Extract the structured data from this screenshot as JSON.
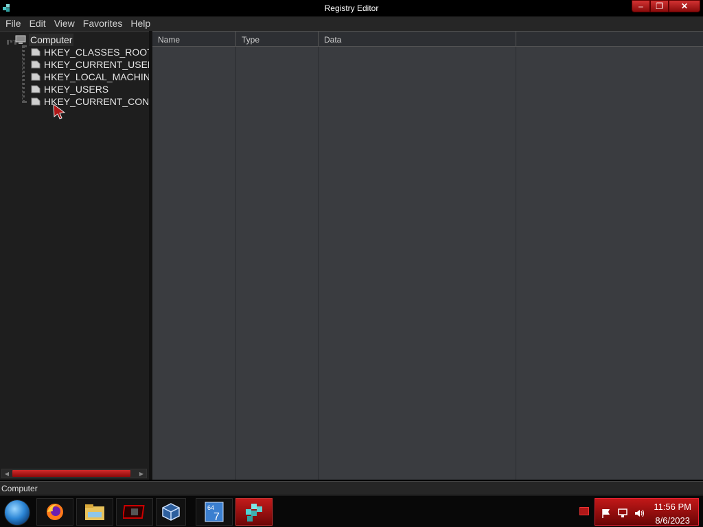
{
  "window": {
    "title": "Registry Editor",
    "min_glyph": "–",
    "max_glyph": "❐",
    "close_glyph": "✕"
  },
  "menu": {
    "items": [
      "File",
      "Edit",
      "View",
      "Favorites",
      "Help"
    ]
  },
  "tree": {
    "root": "Computer",
    "keys": [
      "HKEY_CLASSES_ROOT",
      "HKEY_CURRENT_USER",
      "HKEY_LOCAL_MACHINE",
      "HKEY_USERS",
      "HKEY_CURRENT_CONFIG"
    ]
  },
  "list": {
    "columns": [
      "Name",
      "Type",
      "Data"
    ]
  },
  "status": {
    "path": "Computer"
  },
  "taskbar": {
    "items": [
      "firefox-icon",
      "file-explorer-icon",
      "media-player-icon",
      "virtualbox-icon",
      "windows-7-icon",
      "registry-editor-icon"
    ],
    "clock_time": "11:56 PM",
    "clock_date": "8/6/2023"
  },
  "colors": {
    "accent": "#c11818",
    "pane_bg": "#3a3c40",
    "tree_bg": "#1e1e1e"
  }
}
